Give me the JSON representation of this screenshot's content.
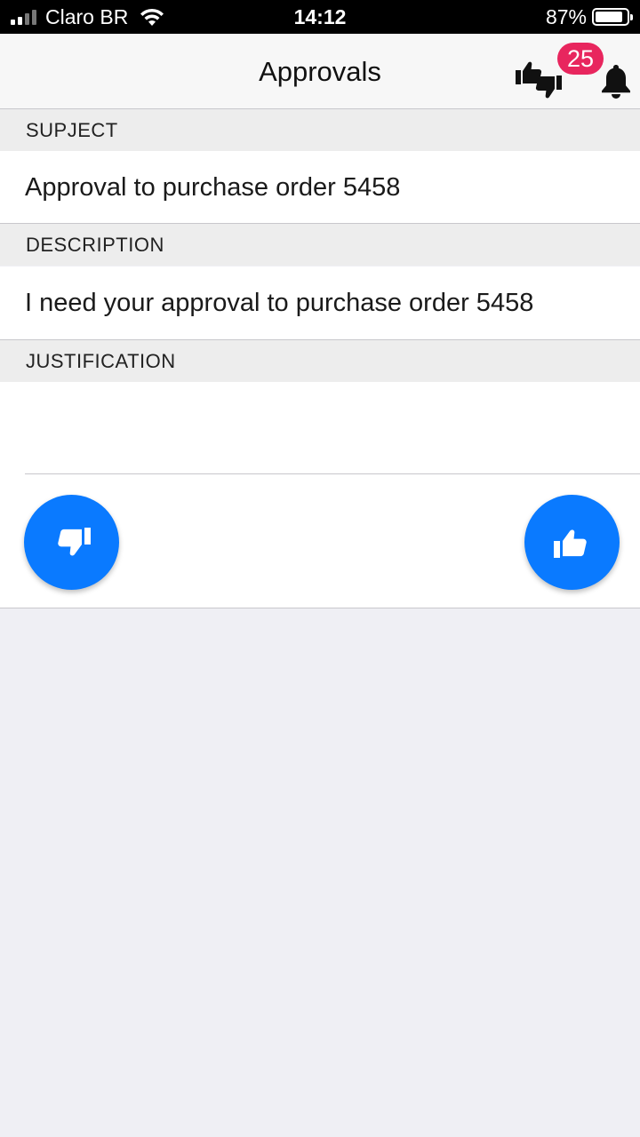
{
  "status_bar": {
    "carrier": "Claro BR",
    "time": "14:12",
    "battery": "87%",
    "battery_level": 0.87
  },
  "nav": {
    "title": "Approvals",
    "badge_count": "25",
    "icons": [
      "thumbs-up-down-icon",
      "bell-icon"
    ]
  },
  "form": {
    "subject_header": "SUPJECT",
    "subject_value": "Approval to purchase order 5458",
    "description_header": "DESCRIPTION",
    "description_value": "I need your approval to purchase order 5458",
    "justification_header": "JUSTIFICATION",
    "justification_value": "",
    "reject_icon": "thumbs-down-icon",
    "approve_icon": "thumbs-up-icon"
  },
  "colors": {
    "accent": "#0a7aff",
    "badge": "#e8265e",
    "section_bg": "#ededed",
    "page_bg": "#efeff4"
  }
}
